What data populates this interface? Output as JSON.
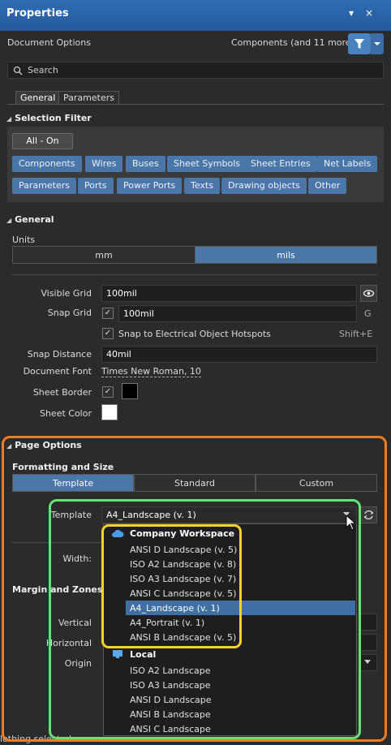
{
  "panel": {
    "title": "Properties",
    "pin_glyph": "▾",
    "close_glyph": "×"
  },
  "header": {
    "left_label": "Document Options",
    "filter_label": "Components (and 11 more)"
  },
  "search": {
    "placeholder": "Search"
  },
  "tabs": [
    {
      "label": "General",
      "active": true
    },
    {
      "label": "Parameters",
      "active": false
    }
  ],
  "selection_filter": {
    "title": "Selection Filter",
    "all_on": "All - On",
    "row1": [
      "Components",
      "Wires",
      "Buses",
      "Sheet Symbols",
      "Sheet Entries",
      "Net Labels"
    ],
    "row2": [
      "Parameters",
      "Ports",
      "Power Ports",
      "Texts",
      "Drawing objects",
      "Other"
    ]
  },
  "general": {
    "title": "General",
    "units_label": "Units",
    "units": [
      {
        "label": "mm",
        "selected": false
      },
      {
        "label": "mils",
        "selected": true
      }
    ],
    "visible_grid_label": "Visible Grid",
    "visible_grid_value": "100mil",
    "snap_grid_label": "Snap Grid",
    "snap_grid_value": "100mil",
    "snap_grid_key": "G",
    "snap_hotspots_label": "Snap to Electrical Object Hotspots",
    "snap_hotspots_key": "Shift+E",
    "snap_distance_label": "Snap Distance",
    "snap_distance_value": "40mil",
    "document_font_label": "Document Font",
    "document_font_value": "Times New Roman, 10",
    "sheet_border_label": "Sheet Border",
    "sheet_color_label": "Sheet Color"
  },
  "page_options": {
    "title": "Page Options",
    "formatting_label": "Formatting and Size",
    "modes": [
      {
        "label": "Template",
        "selected": true
      },
      {
        "label": "Standard",
        "selected": false
      },
      {
        "label": "Custom",
        "selected": false
      }
    ],
    "template_label": "Template",
    "template_value": "A4_Landscape (v. 1)",
    "width_label": "Width:",
    "margin_label": "Margin and Zones",
    "vertical_label": "Vertical",
    "horizontal_label": "Horizontal",
    "origin_label": "Origin",
    "status_text": "lothing selected"
  },
  "template_dropdown": {
    "company_group": "Company Workspace",
    "company_items": [
      "ANSI D Landscape (v. 5)",
      "ISO A2 Landscape (v. 8)",
      "ISO A3 Landscape (v. 7)",
      "ANSI C Landscape (v. 5)",
      "A4_Landscape (v. 1)",
      "A4_Portrait (v. 1)",
      "ANSI B Landscape (v. 5)"
    ],
    "selected_item": "A4_Landscape (v. 1)",
    "local_group": "Local",
    "local_items": [
      "ISO A2 Landscape",
      "ISO A3 Landscape",
      "ANSI D Landscape",
      "ANSI B Landscape",
      "ANSI C Landscape"
    ]
  },
  "colors": {
    "accent": "#4a76a8",
    "titlebar": "#2f6db3",
    "highlight_orange": "#f07c22",
    "highlight_green": "#67e276",
    "highlight_yellow": "#f6d12a"
  }
}
